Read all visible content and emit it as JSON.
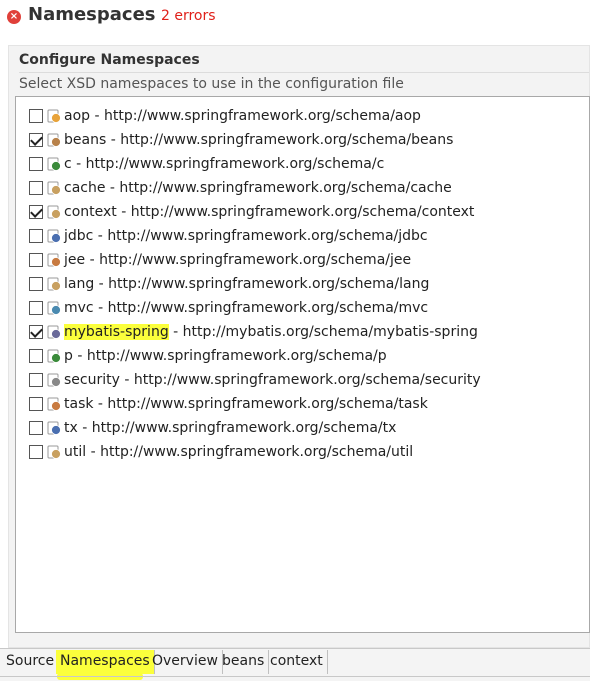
{
  "header": {
    "title": "Namespaces",
    "error_count": "2 errors"
  },
  "section": {
    "title": "Configure Namespaces",
    "description": "Select XSD namespaces to use in the configuration file"
  },
  "namespaces": [
    {
      "label": "aop - http://www.springframework.org/schema/aop",
      "checked": false,
      "icon": "aop-icon",
      "color": "#e8a33a"
    },
    {
      "label": "beans - http://www.springframework.org/schema/beans",
      "checked": true,
      "icon": "bean-icon",
      "color": "#b8824a"
    },
    {
      "label": "c - http://www.springframework.org/schema/c",
      "checked": false,
      "icon": "c-namespace-icon",
      "color": "#3a8a3a"
    },
    {
      "label": "cache - http://www.springframework.org/schema/cache",
      "checked": false,
      "icon": "cache-icon",
      "color": "#c8a060"
    },
    {
      "label": "context - http://www.springframework.org/schema/context",
      "checked": true,
      "icon": "context-icon",
      "color": "#c8a060"
    },
    {
      "label": "jdbc - http://www.springframework.org/schema/jdbc",
      "checked": false,
      "icon": "jdbc-icon",
      "color": "#4a6fb0"
    },
    {
      "label": "jee - http://www.springframework.org/schema/jee",
      "checked": false,
      "icon": "jee-icon",
      "color": "#c87a40"
    },
    {
      "label": "lang - http://www.springframework.org/schema/lang",
      "checked": false,
      "icon": "lang-icon",
      "color": "#c8a060"
    },
    {
      "label": "mvc - http://www.springframework.org/schema/mvc",
      "checked": false,
      "icon": "mvc-icon",
      "color": "#4a8ab0"
    },
    {
      "label_prefix": "mybatis-spring",
      "label_suffix": " - http://mybatis.org/schema/mybatis-spring",
      "checked": true,
      "icon": "xsd-file-icon",
      "color": "#6a6a9a",
      "highlight": true
    },
    {
      "label": "p - http://www.springframework.org/schema/p",
      "checked": false,
      "icon": "p-namespace-icon",
      "color": "#3a8a3a"
    },
    {
      "label": "security - http://www.springframework.org/schema/security",
      "checked": false,
      "icon": "security-icon",
      "color": "#888888"
    },
    {
      "label": "task - http://www.springframework.org/schema/task",
      "checked": false,
      "icon": "task-icon",
      "color": "#c87a40"
    },
    {
      "label": "tx - http://www.springframework.org/schema/tx",
      "checked": false,
      "icon": "tx-icon",
      "color": "#4a6fb0"
    },
    {
      "label": "util - http://www.springframework.org/schema/util",
      "checked": false,
      "icon": "util-icon",
      "color": "#c8a060"
    }
  ],
  "tabs": [
    {
      "label": "Source",
      "active": false
    },
    {
      "label": "Namespaces",
      "active": true
    },
    {
      "label": "Overview",
      "active": false
    },
    {
      "label": "beans",
      "active": false
    },
    {
      "label": "context",
      "active": false
    }
  ],
  "colors": {
    "error": "#e0201a",
    "highlight": "#fbff3c"
  }
}
